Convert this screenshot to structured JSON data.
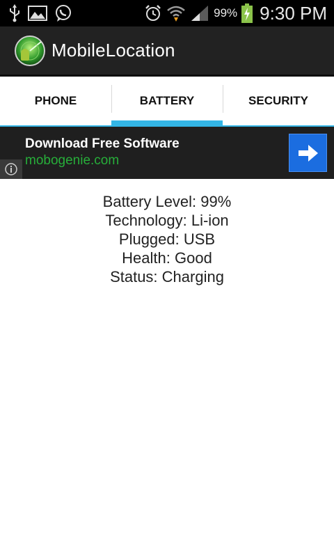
{
  "status_bar": {
    "left_icons": [
      "usb-icon",
      "gallery-icon",
      "whatsapp-icon"
    ],
    "right_icons": [
      "alarm-icon",
      "wifi-icon",
      "signal-icon",
      "battery-charging-icon"
    ],
    "battery_percent": "99%",
    "time": "9:30 PM"
  },
  "action_bar": {
    "title": "MobileLocation",
    "logo_icon": "app-logo-icon"
  },
  "tabs": [
    {
      "label": "PHONE",
      "selected": false
    },
    {
      "label": "BATTERY",
      "selected": true
    },
    {
      "label": "SECURITY",
      "selected": false
    }
  ],
  "ad": {
    "title": "Download Free Software",
    "url": "mobogenie.com",
    "accent": "#1b6de0",
    "url_color": "#27ae3a"
  },
  "battery_info": {
    "level": "Battery Level: 99%",
    "technology": "Technology: Li-ion",
    "plugged": "Plugged: USB",
    "health": "Health: Good",
    "status": "Status: Charging"
  },
  "colors": {
    "tab_indicator": "#33b5e5",
    "action_bar": "#222222"
  }
}
